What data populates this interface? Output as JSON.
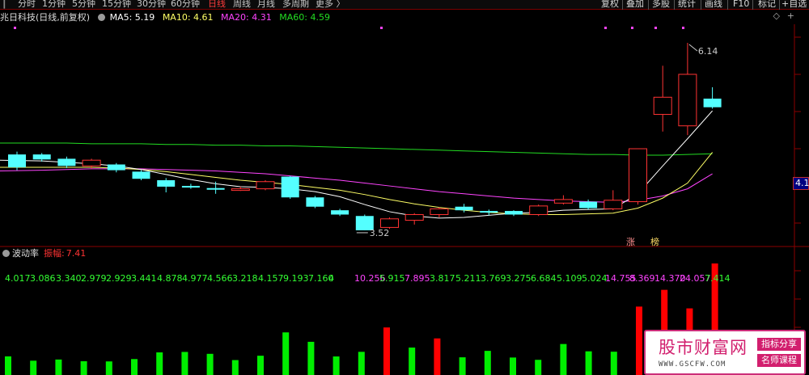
{
  "toolbar": {
    "periods": [
      "分时",
      "1分钟",
      "5分钟",
      "15分钟",
      "30分钟",
      "60分钟",
      "日线",
      "周线",
      "月线",
      "多周期",
      "更多 〉"
    ],
    "active_period": "日线",
    "buttons": [
      "复权",
      "叠加",
      "多股",
      "统计",
      "画线",
      "F10",
      "标记",
      "+自选"
    ]
  },
  "chart_header": {
    "title": "兆日科技(日线,前复权)",
    "ma5": "MA5: 5.19",
    "ma10": "MA10: 4.61",
    "ma20": "MA20: 4.31",
    "ma60": "MA60: 4.59",
    "diamond": "◇",
    "plus": "+"
  },
  "axis_marker": "4.1",
  "annotations": {
    "high": "6.14",
    "low": "3.52",
    "zhang": "涨",
    "bang": "榜"
  },
  "indicator": {
    "name": "波动率",
    "amplitude_label": "振幅:",
    "amplitude_value": "7.41",
    "values": [
      "4.017",
      "3.086",
      "3.340",
      "2.979",
      "2.929",
      "3.441",
      "4.878",
      "4.977",
      "4.566",
      "3.218",
      "4.157",
      "9.193",
      "7.160",
      "4",
      "",
      "10.256",
      "5.915",
      "7.895",
      "3.817",
      "5.211",
      "3.769",
      "3.275",
      "6.684",
      "5.109",
      "5.024",
      "14.755",
      "8.369",
      "14.370",
      "24.057",
      "7.414"
    ]
  },
  "watermark": {
    "title": "股市财富网",
    "url": "WWW.GSCFW.COM",
    "tag1": "指标分享",
    "tag2": "名师课程"
  },
  "colors": {
    "up": "#ff3333",
    "down": "#54ffff",
    "ma5": "#ffffff",
    "ma10": "#ffff66",
    "ma20": "#ff44ff",
    "ma60": "#22dd22",
    "bar_up": "#ff0000",
    "bar_down": "#00ee00"
  },
  "chart_data": {
    "type": "candlestick",
    "candles": [
      {
        "o": 4.58,
        "c": 4.4,
        "h": 4.62,
        "l": 4.36
      },
      {
        "o": 4.58,
        "c": 4.51,
        "h": 4.6,
        "l": 4.48
      },
      {
        "o": 4.52,
        "c": 4.42,
        "h": 4.55,
        "l": 4.39
      },
      {
        "o": 4.42,
        "c": 4.5,
        "h": 4.52,
        "l": 4.38
      },
      {
        "o": 4.44,
        "c": 4.36,
        "h": 4.46,
        "l": 4.33
      },
      {
        "o": 4.34,
        "c": 4.24,
        "h": 4.36,
        "l": 4.22
      },
      {
        "o": 4.22,
        "c": 4.13,
        "h": 4.25,
        "l": 4.05
      },
      {
        "o": 4.14,
        "c": 4.12,
        "h": 4.17,
        "l": 4.1
      },
      {
        "o": 4.11,
        "c": 4.1,
        "h": 4.2,
        "l": 4.03
      },
      {
        "o": 4.09,
        "c": 4.1,
        "h": 4.13,
        "l": 4.07
      },
      {
        "o": 4.1,
        "c": 4.2,
        "h": 4.22,
        "l": 4.08
      },
      {
        "o": 4.27,
        "c": 3.98,
        "h": 4.28,
        "l": 3.96
      },
      {
        "o": 3.98,
        "c": 3.85,
        "h": 4.0,
        "l": 3.83
      },
      {
        "o": 3.8,
        "c": 3.74,
        "h": 3.82,
        "l": 3.72
      },
      {
        "o": 3.72,
        "c": 3.52,
        "h": 3.74,
        "l": 3.52
      },
      {
        "o": 3.56,
        "c": 3.68,
        "h": 3.7,
        "l": 3.54
      },
      {
        "o": 3.66,
        "c": 3.74,
        "h": 3.76,
        "l": 3.6
      },
      {
        "o": 3.74,
        "c": 3.82,
        "h": 3.84,
        "l": 3.7
      },
      {
        "o": 3.85,
        "c": 3.8,
        "h": 3.89,
        "l": 3.77
      },
      {
        "o": 3.79,
        "c": 3.77,
        "h": 3.81,
        "l": 3.73
      },
      {
        "o": 3.79,
        "c": 3.74,
        "h": 3.8,
        "l": 3.72
      },
      {
        "o": 3.74,
        "c": 3.86,
        "h": 3.88,
        "l": 3.72
      },
      {
        "o": 3.9,
        "c": 3.95,
        "h": 4.01,
        "l": 3.88
      },
      {
        "o": 3.92,
        "c": 3.83,
        "h": 3.95,
        "l": 3.81
      },
      {
        "o": 3.82,
        "c": 3.94,
        "h": 4.08,
        "l": 3.8
      },
      {
        "o": 3.92,
        "c": 4.66,
        "h": 4.66,
        "l": 3.88
      },
      {
        "o": 5.14,
        "c": 5.38,
        "h": 5.82,
        "l": 4.9
      },
      {
        "o": 4.98,
        "c": 5.7,
        "h": 6.14,
        "l": 4.85
      },
      {
        "o": 5.36,
        "c": 5.24,
        "h": 5.52,
        "l": 5.22
      }
    ],
    "ma5": [
      4.5,
      4.49,
      4.47,
      4.45,
      4.42,
      4.37,
      4.3,
      4.23,
      4.17,
      4.13,
      4.12,
      4.1,
      4.06,
      3.99,
      3.88,
      3.78,
      3.72,
      3.69,
      3.7,
      3.73,
      3.76,
      3.77,
      3.8,
      3.81,
      3.82,
      4.03,
      4.42,
      4.8,
      5.19
    ],
    "ma10": [
      4.4,
      4.4,
      4.4,
      4.4,
      4.39,
      4.37,
      4.34,
      4.3,
      4.26,
      4.22,
      4.19,
      4.16,
      4.12,
      4.08,
      4.02,
      3.95,
      3.89,
      3.84,
      3.8,
      3.77,
      3.75,
      3.74,
      3.74,
      3.75,
      3.76,
      3.83,
      3.97,
      4.18,
      4.61
    ],
    "ma20": [
      4.35,
      4.36,
      4.37,
      4.38,
      4.38,
      4.38,
      4.37,
      4.36,
      4.35,
      4.33,
      4.31,
      4.28,
      4.25,
      4.22,
      4.18,
      4.14,
      4.1,
      4.06,
      4.03,
      4.0,
      3.97,
      3.95,
      3.93,
      3.92,
      3.91,
      3.94,
      4.0,
      4.1,
      4.31
    ],
    "ma60": [
      4.74,
      4.74,
      4.74,
      4.73,
      4.73,
      4.73,
      4.72,
      4.72,
      4.71,
      4.71,
      4.7,
      4.7,
      4.69,
      4.68,
      4.67,
      4.66,
      4.65,
      4.64,
      4.63,
      4.62,
      4.61,
      4.6,
      4.59,
      4.58,
      4.58,
      4.57,
      4.57,
      4.58,
      4.59
    ],
    "volatility": [
      4.017,
      3.086,
      3.34,
      2.979,
      2.929,
      3.441,
      4.878,
      4.977,
      4.566,
      3.218,
      4.157,
      9.193,
      7.16,
      4.0,
      5.0,
      10.256,
      5.915,
      7.895,
      3.817,
      5.211,
      3.769,
      3.275,
      6.684,
      5.109,
      5.024,
      14.755,
      18.369,
      14.37,
      24.057,
      7.414
    ],
    "vol_up": [
      false,
      false,
      false,
      false,
      false,
      false,
      false,
      false,
      false,
      false,
      false,
      false,
      false,
      false,
      false,
      true,
      false,
      true,
      false,
      false,
      false,
      false,
      false,
      false,
      false,
      true,
      true,
      true,
      true,
      false
    ],
    "ylim": [
      3.35,
      6.4
    ]
  }
}
